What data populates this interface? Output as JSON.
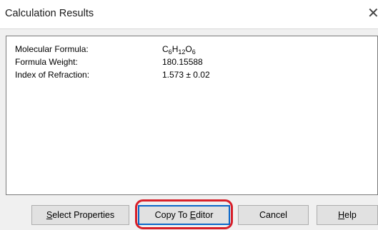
{
  "window": {
    "title": "Calculation Results",
    "close_glyph": "✕"
  },
  "results": [
    {
      "label": "Molecular Formula:",
      "value_parts": [
        [
          "C",
          ""
        ],
        [
          "6",
          "sub"
        ],
        [
          "H",
          ""
        ],
        [
          "12",
          "sub"
        ],
        [
          "O",
          ""
        ],
        [
          "6",
          "sub"
        ]
      ]
    },
    {
      "label": "Formula Weight:",
      "value": "180.15588"
    },
    {
      "label": "Index of Refraction:",
      "value": "1.573 ± 0.02"
    }
  ],
  "buttons": {
    "select_properties": {
      "pre": "",
      "mnemonic": "S",
      "post": "elect Properties"
    },
    "copy_to_editor": {
      "pre": "Copy To ",
      "mnemonic": "E",
      "post": "ditor"
    },
    "cancel": {
      "label": "Cancel"
    },
    "help": {
      "pre": "",
      "mnemonic": "H",
      "post": "elp"
    }
  },
  "colors": {
    "highlight": "#d8202a",
    "default_button_border": "#0a66c8"
  }
}
